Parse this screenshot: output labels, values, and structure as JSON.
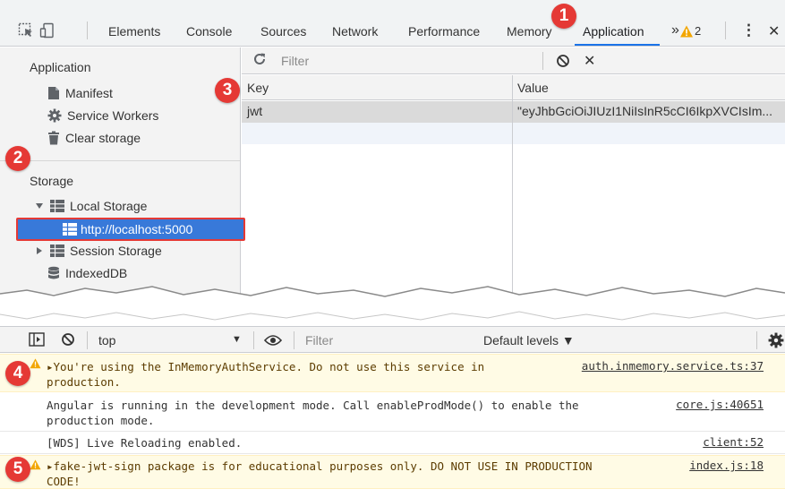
{
  "toolbar": {
    "tabs": [
      "Elements",
      "Console",
      "Sources",
      "Network",
      "Performance",
      "Memory",
      "Application"
    ],
    "more": "»",
    "warning_count": "2",
    "menu": "⋮",
    "close": "✕"
  },
  "sidebar": {
    "application_header": "Application",
    "application_items": [
      "Manifest",
      "Service Workers",
      "Clear storage"
    ],
    "storage_header": "Storage",
    "local_storage": "Local Storage",
    "selected_origin": "http://localhost:5000",
    "session_storage": "Session Storage",
    "indexeddb": "IndexedDB"
  },
  "storage_view": {
    "filter_placeholder": "Filter",
    "columns": [
      "Key",
      "Value"
    ],
    "rows": [
      {
        "key": "jwt",
        "value": "\"eyJhbGciOiJIUzI1NiIsInR5cCI6IkpXVCIsIm..."
      }
    ]
  },
  "console": {
    "context": "top",
    "filter_placeholder": "Filter",
    "levels": "Default levels ▼",
    "messages": [
      {
        "type": "warn",
        "line1": "▸You're using the InMemoryAuthService. Do not use this service in",
        "line2": "production.",
        "source": "auth.inmemory.service.ts:37"
      },
      {
        "type": "log",
        "line1": "Angular is running in the development mode. Call enableProdMode() to enable the",
        "line2": "production mode.",
        "source": "core.js:40651"
      },
      {
        "type": "log",
        "line1": "[WDS] Live Reloading enabled.",
        "line2": "",
        "source": "client:52"
      },
      {
        "type": "warn",
        "line1": "▸fake-jwt-sign package is for educational purposes only. DO NOT USE IN PRODUCTION",
        "line2": "CODE!",
        "source": "index.js:18"
      }
    ]
  },
  "callouts": [
    "1",
    "2",
    "3",
    "4",
    "5"
  ],
  "colors": {
    "callout": "#e53935",
    "selection": "#3879d9",
    "active_tab_underline": "#1a73e8",
    "warning_bg": "#fffbe5",
    "warning_icon": "#f2a600"
  }
}
